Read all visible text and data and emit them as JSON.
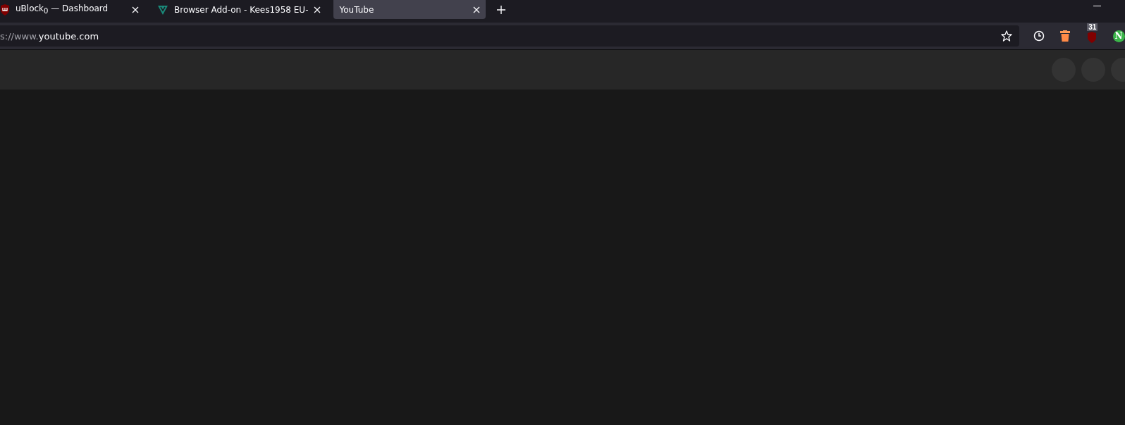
{
  "tabs": [
    {
      "title": "uBlock$_{0}$ — Dashboard",
      "kind": "ublock",
      "selected": false
    },
    {
      "title": "Browser Add-on - Kees1958 EU-",
      "kind": "shield",
      "selected": false
    },
    {
      "title": "YouTube",
      "kind": "none",
      "selected": true
    }
  ],
  "address_bar": {
    "scheme": "s://www.",
    "host": "youtube.com"
  },
  "extensions": [
    {
      "kind": "clock"
    },
    {
      "kind": "trash"
    },
    {
      "kind": "ublock",
      "badge": "31"
    },
    {
      "kind": "letter",
      "label": "N"
    }
  ]
}
